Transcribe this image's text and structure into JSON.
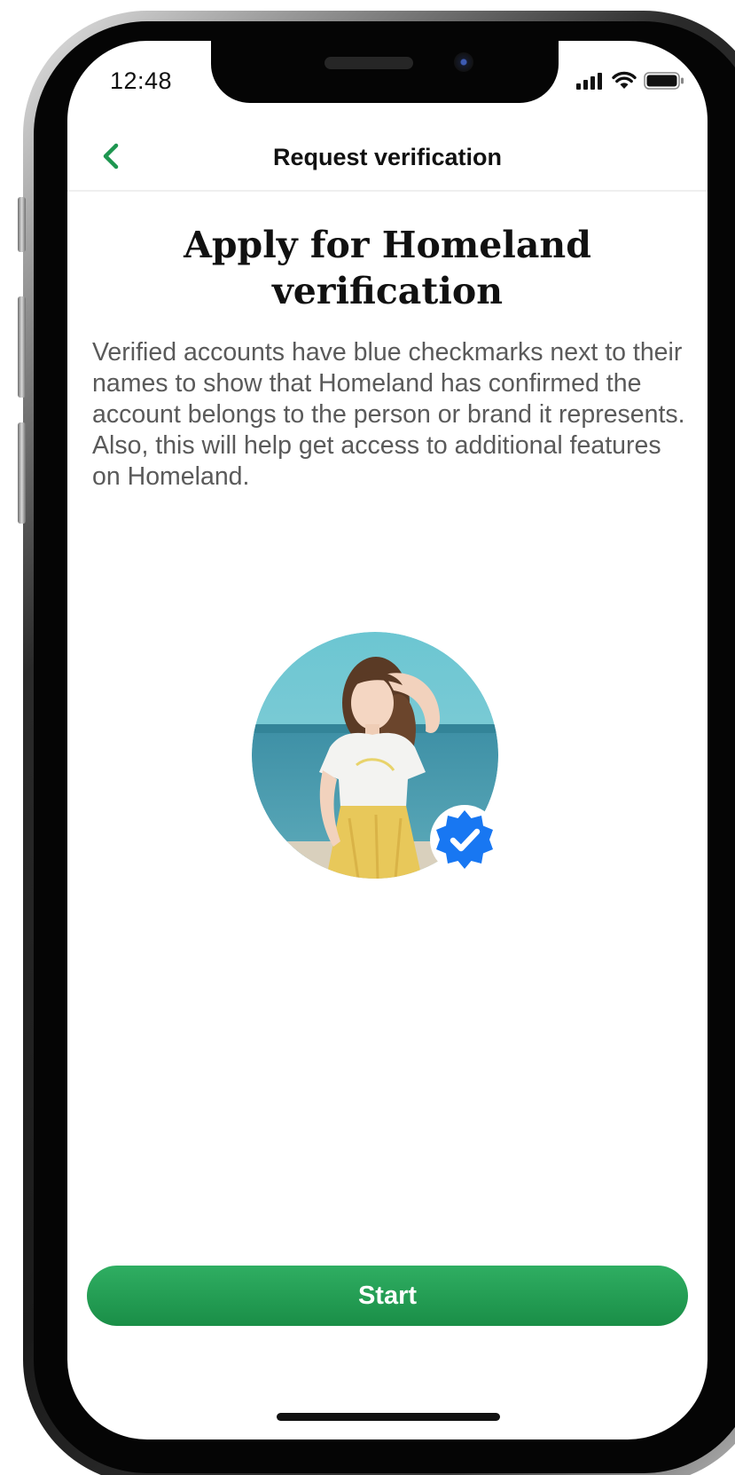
{
  "status_bar": {
    "time": "12:48",
    "icons": [
      "signal-icon",
      "wifi-icon",
      "battery-icon"
    ]
  },
  "nav": {
    "back_icon": "chevron-left-icon",
    "title": "Request verification"
  },
  "main": {
    "heading": "Apply for Homeland verification",
    "description": "Verified accounts have blue checkmarks next to their names to show that Homeland has confirmed the account belongs to the person or brand it represents. Also, this will help get access to additional features on Homeland.",
    "avatar_badge_icon": "verified-check-icon"
  },
  "actions": {
    "start_label": "Start"
  },
  "colors": {
    "accent_green": "#1E9650",
    "verified_blue": "#1877F2",
    "text_primary": "#111111",
    "text_secondary": "#5A5A5A"
  }
}
